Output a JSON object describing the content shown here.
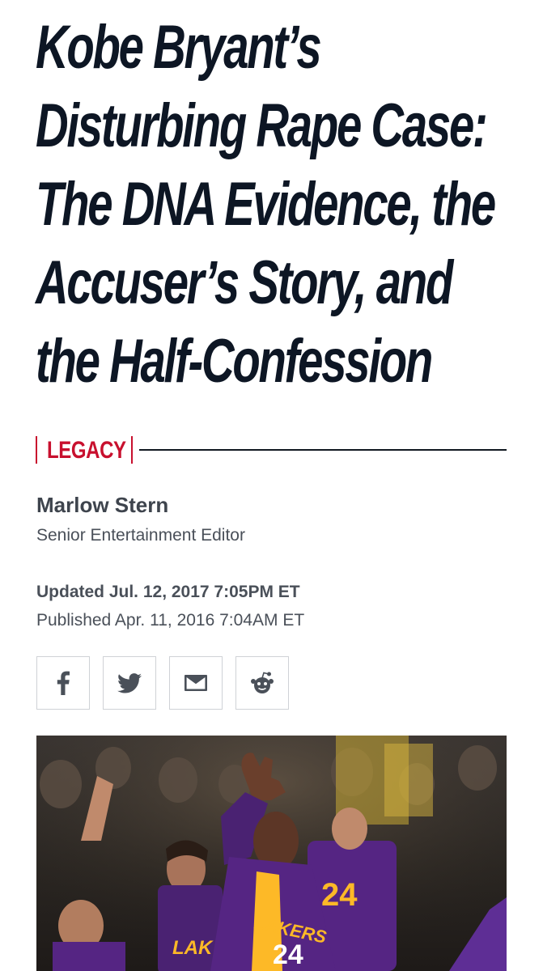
{
  "headline": {
    "lines": [
      "Kobe Bryant’s",
      "Disturbing Rape Case:",
      "The DNA Evidence, the",
      "Accuser’s Story, and",
      "the Half-Confession"
    ]
  },
  "section": {
    "label": "LEGACY"
  },
  "byline": {
    "author": "Marlow Stern",
    "role": "Senior Entertainment Editor"
  },
  "dates": {
    "updated": "Updated Jul. 12, 2017 7:05PM ET",
    "published": "Published Apr. 11, 2016 7:04AM ET"
  },
  "share": {
    "buttons": [
      "facebook-icon",
      "twitter-icon",
      "email-icon",
      "reddit-icon"
    ]
  },
  "hero": {
    "jersey_text": "LAKERS",
    "numbers": [
      "24",
      "24"
    ],
    "colors": {
      "lakers_purple": "#552583",
      "lakers_gold": "#fdb927"
    }
  },
  "colors": {
    "accent": "#c8102e",
    "headline": "#0d1624"
  }
}
